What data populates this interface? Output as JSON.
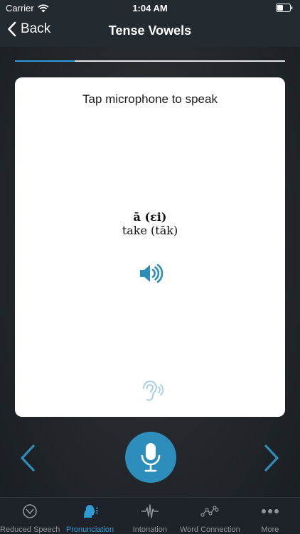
{
  "status_bar": {
    "carrier": "Carrier",
    "time": "1:04 AM"
  },
  "nav": {
    "back_label": "Back",
    "title": "Tense Vowels"
  },
  "progress": {
    "fraction": 0.22,
    "color": "#2f9bd6"
  },
  "card": {
    "instruction": "Tap microphone to speak",
    "symbol": "ā (εi)",
    "example": "take (tāk)"
  },
  "icons": {
    "speaker": "speaker-icon",
    "ear": "ear-icon",
    "microphone": "microphone-icon",
    "prev": "chevron-left-icon",
    "next": "chevron-right-icon"
  },
  "tabs": [
    {
      "label": "Reduced Speech",
      "icon": "reduced-speech-icon",
      "active": false
    },
    {
      "label": "Pronunciation",
      "icon": "pronunciation-icon",
      "active": true
    },
    {
      "label": "Intonation",
      "icon": "waveform-icon",
      "active": false
    },
    {
      "label": "Word Connection",
      "icon": "word-connection-icon",
      "active": false
    },
    {
      "label": "More",
      "icon": "more-icon",
      "active": false
    }
  ],
  "colors": {
    "accent": "#2f9bd6",
    "mic_bg": "#2d8dbb",
    "bar_bg": "#232a30"
  }
}
